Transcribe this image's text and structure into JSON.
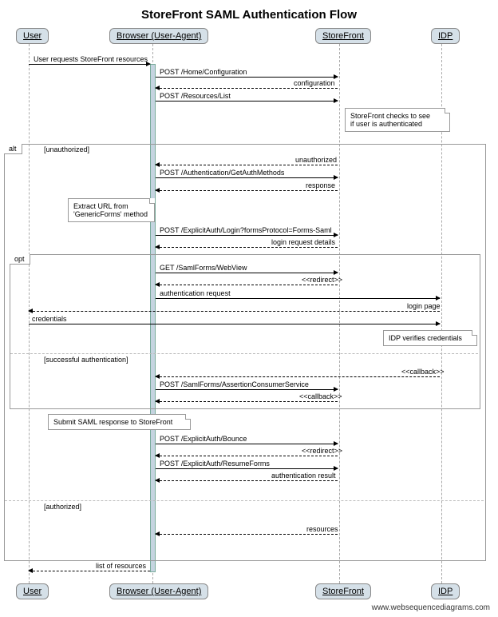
{
  "title": "StoreFront SAML Authentication Flow",
  "participants": {
    "user": "User",
    "browser": "Browser (User-Agent)",
    "storefront": "StoreFront",
    "idp": "IDP"
  },
  "messages": {
    "m1": "User requests StoreFront resources",
    "m2": "POST /Home/Configuration",
    "m3": "configuration",
    "m4": "POST /Resources/List",
    "note1": "StoreFront checks to see\nif user is authenticated",
    "m5": "unauthorized",
    "m6": "POST /Authentication/GetAuthMethods",
    "m7": "response",
    "note2": "Extract URL from\n'GenericForms' method",
    "m8": "POST /ExplicitAuth/Login?formsProtocol=Forms-Saml",
    "m9": "login request details",
    "m10": "GET /SamlForms/WebView",
    "m11": "<<redirect>>",
    "m12": "authentication request",
    "m13": "login page",
    "m14": "credentials",
    "note3": "IDP verifies credentials",
    "m15": "<<callback>>",
    "m16": "POST /SamlForms/AssertionConsumerService",
    "m17": "<<callback>>",
    "note4": "Submit SAML response to StoreFront",
    "m18": "POST /ExplicitAuth/Bounce",
    "m19": "<<redirect>>",
    "m20": "POST /ExplicitAuth/ResumeForms",
    "m21": "authentication result",
    "m22": "resources",
    "m23": "list of resources"
  },
  "frames": {
    "alt": "alt",
    "opt": "opt"
  },
  "conditions": {
    "unauthorized": "[unauthorized]",
    "successful": "[successful authentication]",
    "authorized": "[authorized]"
  },
  "watermark": "www.websequencediagrams.com"
}
